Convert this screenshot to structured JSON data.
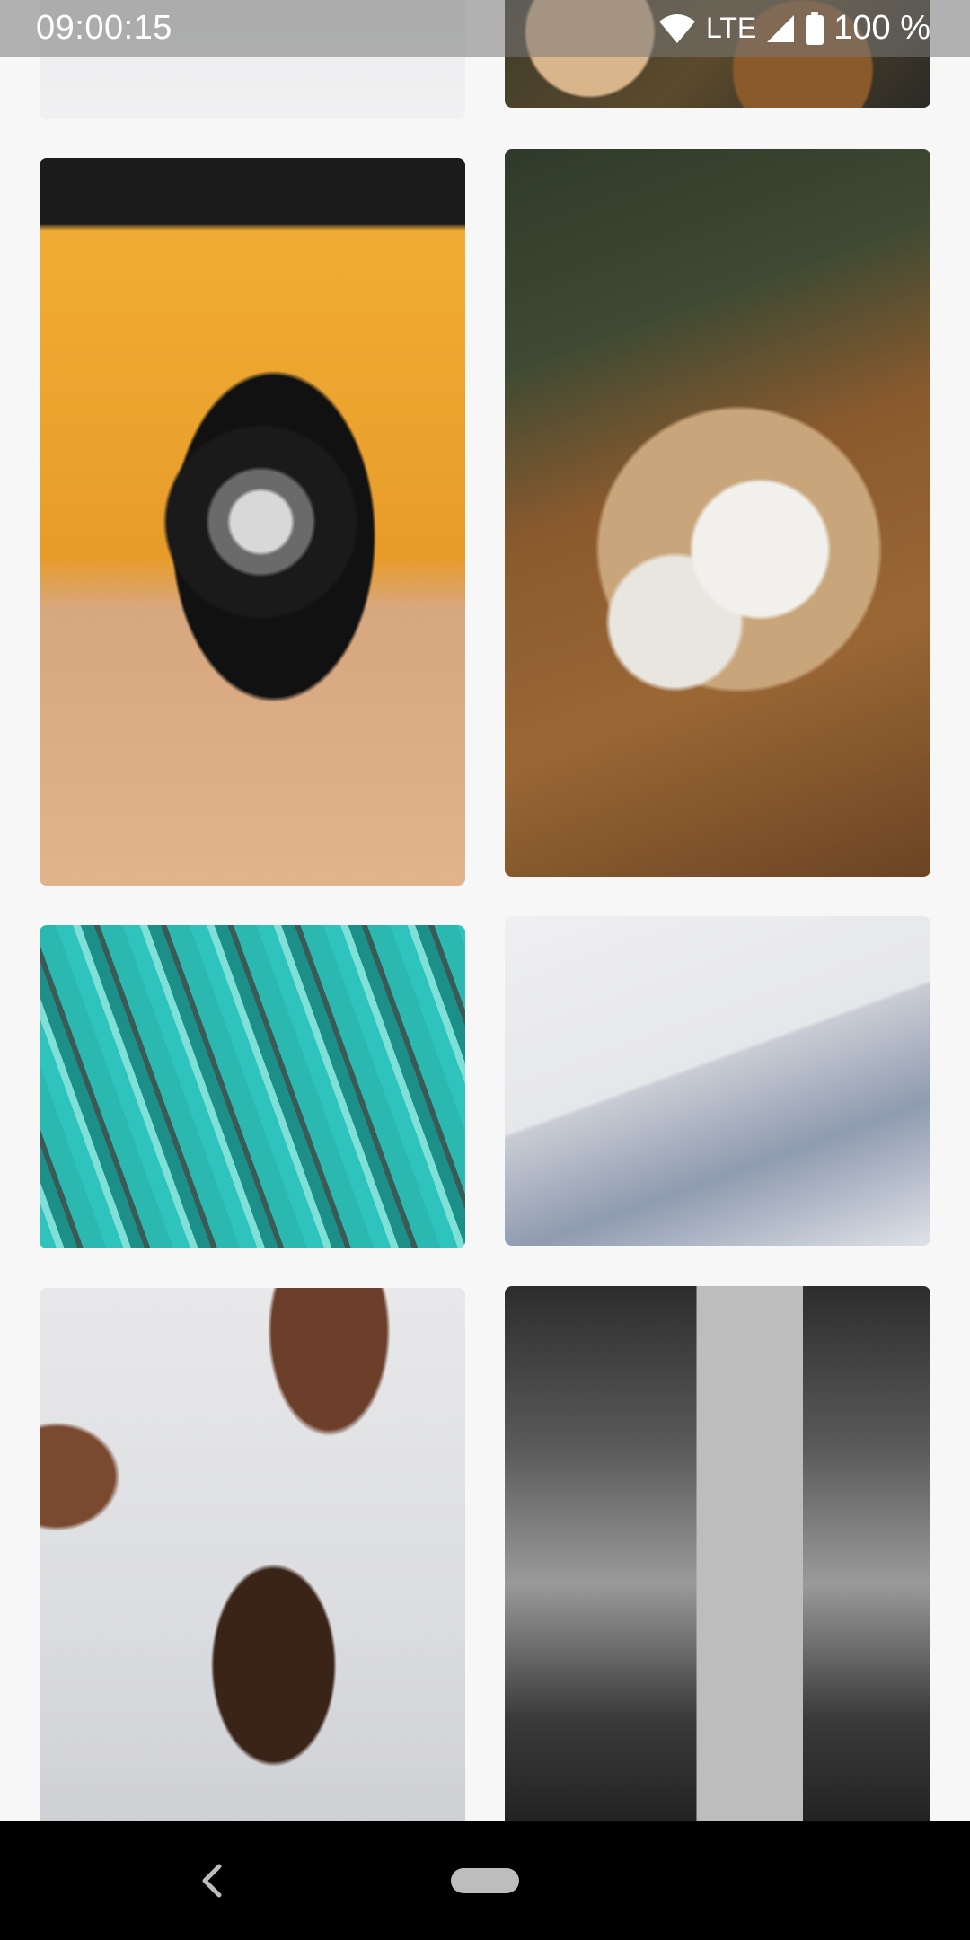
{
  "status_bar": {
    "time": "09:00:15",
    "network": "LTE",
    "battery": "100 %",
    "icons": [
      "wifi-icon",
      "signal-icon",
      "battery-icon"
    ]
  },
  "gallery": {
    "photos": [
      {
        "subject": "snow-top"
      },
      {
        "subject": "market-produce"
      },
      {
        "subject": "yellow-car-wheel"
      },
      {
        "subject": "coffee-table-breakfast"
      },
      {
        "subject": "turquoise-fluid-art"
      },
      {
        "subject": "snow-hikers"
      },
      {
        "subject": "chocolate-cups"
      },
      {
        "subject": "city-street-crowd"
      }
    ]
  },
  "nav_bar": {
    "icons": [
      "back-icon",
      "home-pill"
    ]
  },
  "colors": {
    "background": "#f7f7f7",
    "nav_bar": "#000000",
    "status_text": "#ffffff"
  }
}
